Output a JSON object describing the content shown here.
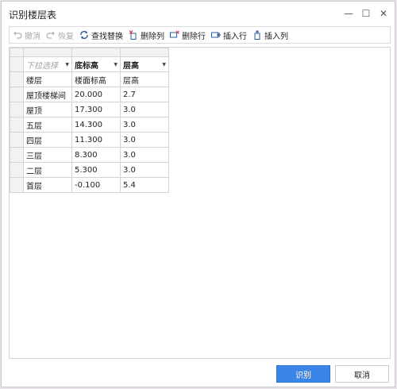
{
  "window": {
    "title": "识别楼层表",
    "minimize_glyph": "—",
    "maximize_glyph": "☐",
    "close_glyph": "✕"
  },
  "toolbar": {
    "undo_label": "撤消",
    "redo_label": "恢复",
    "find_replace_label": "查找替换",
    "delete_column_label": "删除列",
    "delete_row_label": "删除行",
    "insert_row_label": "插入行",
    "insert_column_label": "插入列"
  },
  "grid": {
    "column_headers": [
      {
        "label": "下拉选择",
        "placeholder": true
      },
      {
        "label": "底标高",
        "placeholder": false
      },
      {
        "label": "层高",
        "placeholder": false
      }
    ],
    "rows": [
      [
        "楼层",
        "楼面标高",
        "层高"
      ],
      [
        "屋顶楼梯间",
        "20.000",
        "2.7"
      ],
      [
        "屋顶",
        "17.300",
        "3.0"
      ],
      [
        "五层",
        "14.300",
        "3.0"
      ],
      [
        "四层",
        "11.300",
        "3.0"
      ],
      [
        "三层",
        "8.300",
        "3.0"
      ],
      [
        "二层",
        "5.300",
        "3.0"
      ],
      [
        "首层",
        "-0.100",
        "5.4"
      ]
    ]
  },
  "footer": {
    "identify_label": "识别",
    "cancel_label": "取消"
  },
  "colors": {
    "accent": "#3a86e8",
    "toolbar_icon": "#2f5d9a",
    "grid_border": "#d4d4d4",
    "header_bg": "#f2f2f2"
  }
}
